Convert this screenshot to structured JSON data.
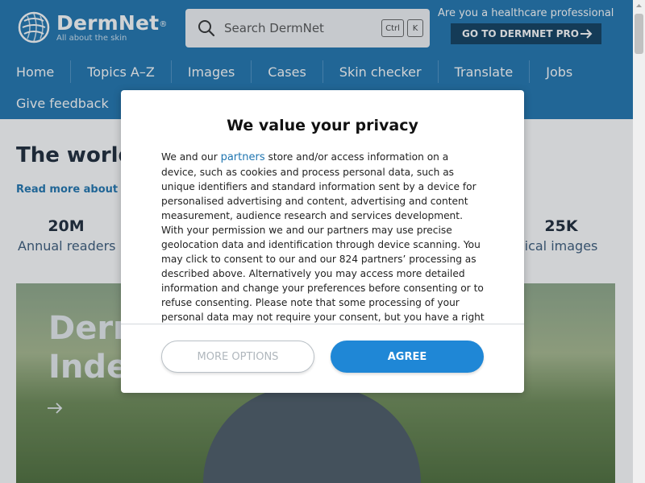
{
  "header": {
    "logo_name": "DermNet",
    "logo_reg": "®",
    "logo_tagline": "All about the skin",
    "search_placeholder": "Search DermNet",
    "shortcut_ctrl": "Ctrl",
    "shortcut_k": "K",
    "pro_label": "Are you a healthcare professional",
    "pro_button": "GO TO DERMNET PRO"
  },
  "nav": {
    "row1": [
      "Home",
      "Topics A–Z",
      "Images",
      "Cases",
      "Skin checker",
      "Translate",
      "Jobs"
    ],
    "row2": [
      "Give feedback"
    ]
  },
  "main": {
    "title": "The world",
    "read_more": "Read more about D",
    "stats": [
      {
        "value": "20M",
        "label": "Annual readers"
      },
      {
        "value": "25K",
        "label": "ical images"
      }
    ],
    "hero_title_line1": "Derm",
    "hero_title_line2": "Inde"
  },
  "modal": {
    "title": "We value your privacy",
    "body_before": "We and our ",
    "partners_link": "partners",
    "body_after": " store and/or access information on a device, such as cookies and process personal data, such as unique identifiers and standard information sent by a device for personalised advertising and content, advertising and content measurement, audience research and services development. With your permission we and our partners may use precise geolocation data and identification through device scanning. You may click to consent to our and our 824 partners’ processing as described above. Alternatively you may access more detailed information and change your preferences before consenting or to refuse consenting. Please note that some processing of your personal data may not require your consent, but you have a right to object",
    "more_options": "MORE OPTIONS",
    "agree": "AGREE"
  },
  "colors": {
    "header_bg": "#1f75b0",
    "pro_button_bg": "#0f3e5f",
    "agree_bg": "#1f87d6"
  },
  "icons": [
    "logo-globe-icon",
    "search-icon",
    "arrow-right-icon",
    "scroll-up-icon"
  ]
}
